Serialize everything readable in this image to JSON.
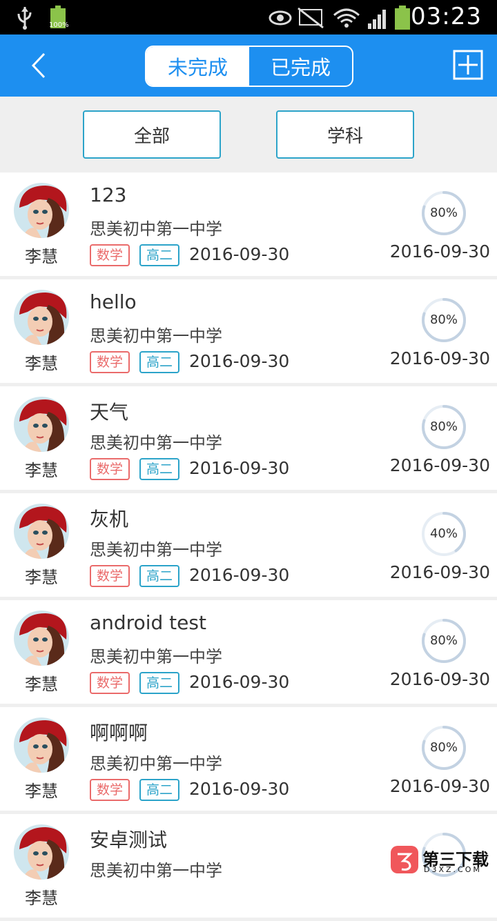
{
  "status_bar": {
    "battery_small": "100%",
    "time": "03:23"
  },
  "header": {
    "tabs": [
      {
        "label": "未完成",
        "active": true
      },
      {
        "label": "已完成",
        "active": false
      }
    ]
  },
  "filters": {
    "all_label": "全部",
    "subject_label": "学科"
  },
  "tasks": [
    {
      "title": "123",
      "school": "思美初中第一中学",
      "user": "李慧",
      "subject": "数学",
      "grade": "高二",
      "date": "2016-09-30",
      "progress_label": "80%",
      "progress": 0.8,
      "due": "2016-09-30"
    },
    {
      "title": "hello",
      "school": "思美初中第一中学",
      "user": "李慧",
      "subject": "数学",
      "grade": "高二",
      "date": "2016-09-30",
      "progress_label": "80%",
      "progress": 0.8,
      "due": "2016-09-30"
    },
    {
      "title": "天气",
      "school": "思美初中第一中学",
      "user": "李慧",
      "subject": "数学",
      "grade": "高二",
      "date": "2016-09-30",
      "progress_label": "80%",
      "progress": 0.8,
      "due": "2016-09-30"
    },
    {
      "title": "灰机",
      "school": "思美初中第一中学",
      "user": "李慧",
      "subject": "数学",
      "grade": "高二",
      "date": "2016-09-30",
      "progress_label": "40%",
      "progress": 0.4,
      "due": "2016-09-30"
    },
    {
      "title": "android  test",
      "school": "思美初中第一中学",
      "user": "李慧",
      "subject": "数学",
      "grade": "高二",
      "date": "2016-09-30",
      "progress_label": "80%",
      "progress": 0.8,
      "due": "2016-09-30"
    },
    {
      "title": "啊啊啊",
      "school": "思美初中第一中学",
      "user": "李慧",
      "subject": "数学",
      "grade": "高二",
      "date": "2016-09-30",
      "progress_label": "80%",
      "progress": 0.8,
      "due": "2016-09-30"
    },
    {
      "title": "安卓测试",
      "school": "思美初中第一中学",
      "user": "李慧",
      "subject": "",
      "grade": "",
      "date": "",
      "progress_label": "",
      "progress": 0.8,
      "due": ""
    }
  ],
  "watermark": {
    "text": "第三下载",
    "sub": "D3XZ.COM"
  },
  "colors": {
    "header_bg": "#1d8ff0",
    "accent_teal": "#2ba3c9",
    "subject_red": "#ea6a6a",
    "progress_ring": "#c9d7e6"
  }
}
